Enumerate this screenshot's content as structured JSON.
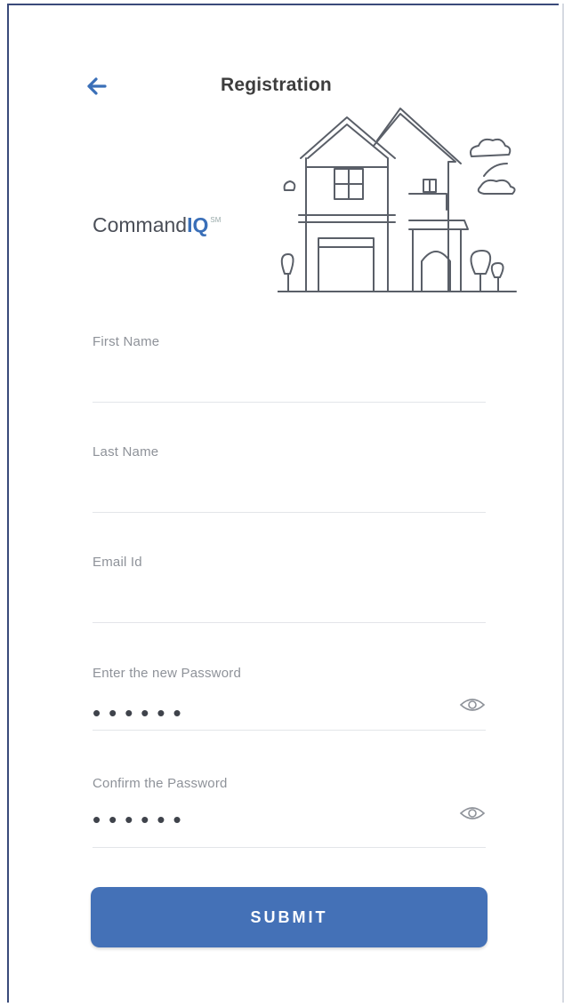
{
  "header": {
    "title": "Registration",
    "back_icon": "arrow-left-icon"
  },
  "brand": {
    "name_plain": "Command",
    "name_bold": "IQ",
    "mark": "SM"
  },
  "form": {
    "first_name": {
      "label": "First Name",
      "value": ""
    },
    "last_name": {
      "label": "Last Name",
      "value": ""
    },
    "email": {
      "label": "Email Id",
      "value": ""
    },
    "new_password": {
      "label": "Enter the new Password",
      "value": "••••••",
      "toggle_icon": "eye-icon"
    },
    "confirm_password": {
      "label": "Confirm the Password",
      "value": "••••••",
      "toggle_icon": "eye-icon"
    }
  },
  "submit_label": "SUBMIT",
  "colors": {
    "accent": "#4471b7",
    "title": "#3d3d3d",
    "label": "#8e9299"
  }
}
